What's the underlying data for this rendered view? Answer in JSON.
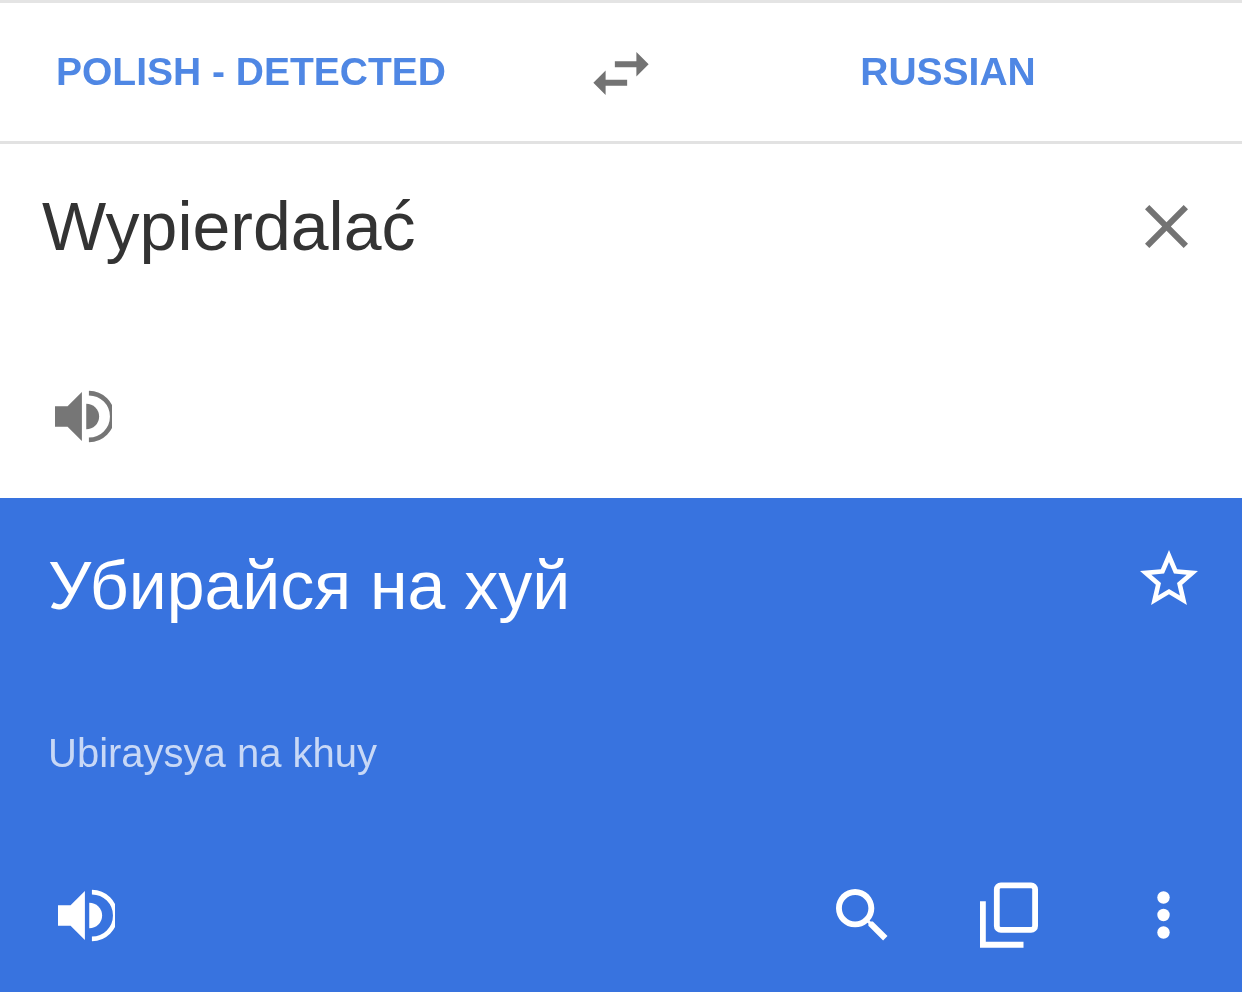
{
  "language_bar": {
    "source_language": "POLISH - DETECTED",
    "target_language": "RUSSIAN"
  },
  "source": {
    "text": "Wypierdalać"
  },
  "translation": {
    "text": "Убирайся на хуй",
    "transliteration": "Ubiraysya na khuy",
    "starred": false
  }
}
